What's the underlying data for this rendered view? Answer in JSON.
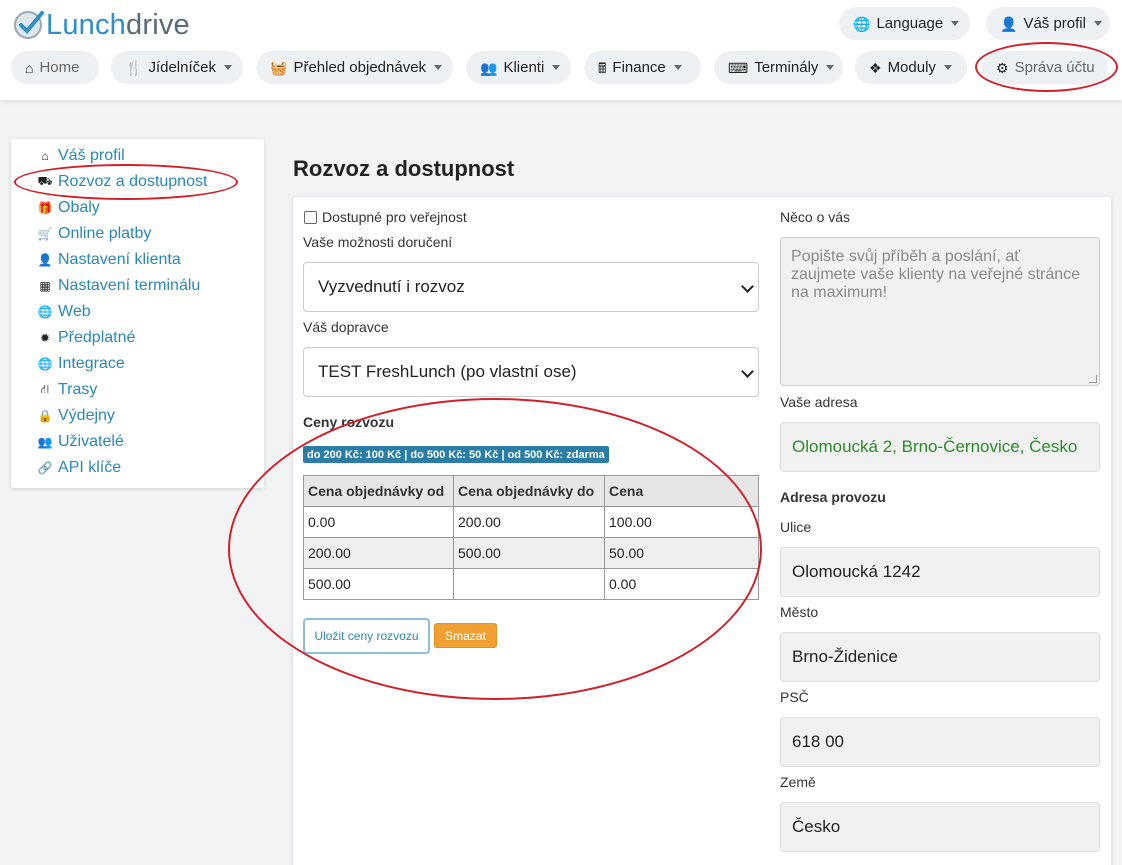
{
  "header": {
    "logo_part1": "Lunch",
    "logo_part2": "drive",
    "language_label": "Language",
    "profile_label": "Váš profil"
  },
  "nav": {
    "home": "Home",
    "menu": "Jídelníček",
    "orders": "Přehled objednávek",
    "clients": "Klienti",
    "finance": "Finance",
    "terminals": "Terminály",
    "modules": "Moduly",
    "account": "Správa účtu"
  },
  "sidebar": {
    "items": [
      {
        "label": "Váš profil",
        "icon": "home-icon"
      },
      {
        "label": "Rozvoz a dostupnost",
        "icon": "truck-icon"
      },
      {
        "label": "Obaly",
        "icon": "gift-icon"
      },
      {
        "label": "Online platby",
        "icon": "cart-icon"
      },
      {
        "label": "Nastavení klienta",
        "icon": "user-icon"
      },
      {
        "label": "Nastavení terminálu",
        "icon": "grid-icon"
      },
      {
        "label": "Web",
        "icon": "globe-icon"
      },
      {
        "label": "Předplatné",
        "icon": "certificate-icon"
      },
      {
        "label": "Integrace",
        "icon": "globe-icon"
      },
      {
        "label": "Trasy",
        "icon": "road-icon"
      },
      {
        "label": "Výdejny",
        "icon": "lock-icon"
      },
      {
        "label": "Uživatelé",
        "icon": "users-icon"
      },
      {
        "label": "API klíče",
        "icon": "link-icon"
      }
    ]
  },
  "main": {
    "title": "Rozvoz a dostupnost",
    "public_checkbox_label": "Dostupné pro veřejnost",
    "delivery_options_label": "Vaše možnosti doručení",
    "delivery_option_value": "Vyzvednutí i rozvoz",
    "carrier_label": "Váš dopravce",
    "carrier_value": "TEST FreshLunch (po vlastní ose)",
    "prices_heading": "Ceny rozvozu",
    "prices_badge": "do 200 Kč: 100 Kč | do 500 Kč: 50 Kč | od 500 Kč: zdarma",
    "table": {
      "headers": [
        "Cena objednávky od",
        "Cena objednávky do",
        "Cena"
      ],
      "rows": [
        [
          "0.00",
          "200.00",
          "100.00"
        ],
        [
          "200.00",
          "500.00",
          "50.00"
        ],
        [
          "500.00",
          "",
          "0.00"
        ]
      ]
    },
    "save_prices_button": "Uložit ceny rozvozu",
    "delete_button": "Smazat",
    "about_label": "Něco o vás",
    "about_placeholder": "Popište svůj příběh a poslání, ať zaujmete vaše klienty na veřejné stránce na maximum!",
    "address_label": "Vaše adresa",
    "address_value": "Olomoucká 2, Brno-Černovice, Česko",
    "operation_address_heading": "Adresa provozu",
    "street_label": "Ulice",
    "street_value": "Olomoucká 1242",
    "city_label": "Město",
    "city_value": "Brno-Židenice",
    "zip_label": "PSČ",
    "zip_value": "618 00",
    "country_label": "Země",
    "country_value": "Česko"
  },
  "colors": {
    "accent": "#2a88b5",
    "annotation_red": "#d0202a",
    "orange_button": "#f0a030"
  }
}
